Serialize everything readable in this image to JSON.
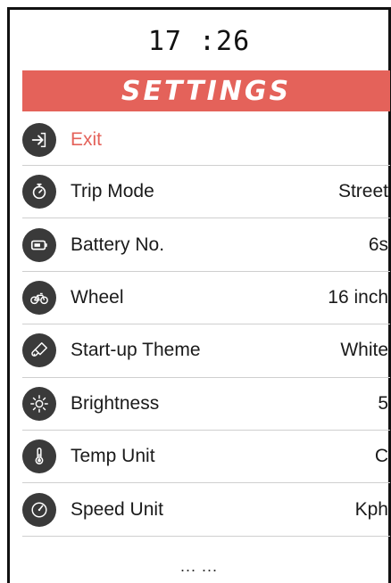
{
  "clock": "17 :26",
  "title": "SETTINGS",
  "items": [
    {
      "label": "Exit",
      "value": "",
      "icon": "exit-icon"
    },
    {
      "label": "Trip Mode",
      "value": "Street",
      "icon": "stopwatch-icon"
    },
    {
      "label": "Battery No.",
      "value": "6s",
      "icon": "battery-icon"
    },
    {
      "label": "Wheel",
      "value": "16 inch",
      "icon": "bicycle-icon"
    },
    {
      "label": "Start-up Theme",
      "value": "White",
      "icon": "paint-brush-icon"
    },
    {
      "label": "Brightness",
      "value": "5",
      "icon": "sun-icon"
    },
    {
      "label": "Temp Unit",
      "value": "C",
      "icon": "thermometer-icon"
    },
    {
      "label": "Speed Unit",
      "value": "Kph",
      "icon": "speedometer-icon"
    }
  ],
  "more": "... ...",
  "colors": {
    "accent": "#e4625a",
    "icon_bg": "#3a3a3a",
    "divider": "#cfcfcf"
  }
}
